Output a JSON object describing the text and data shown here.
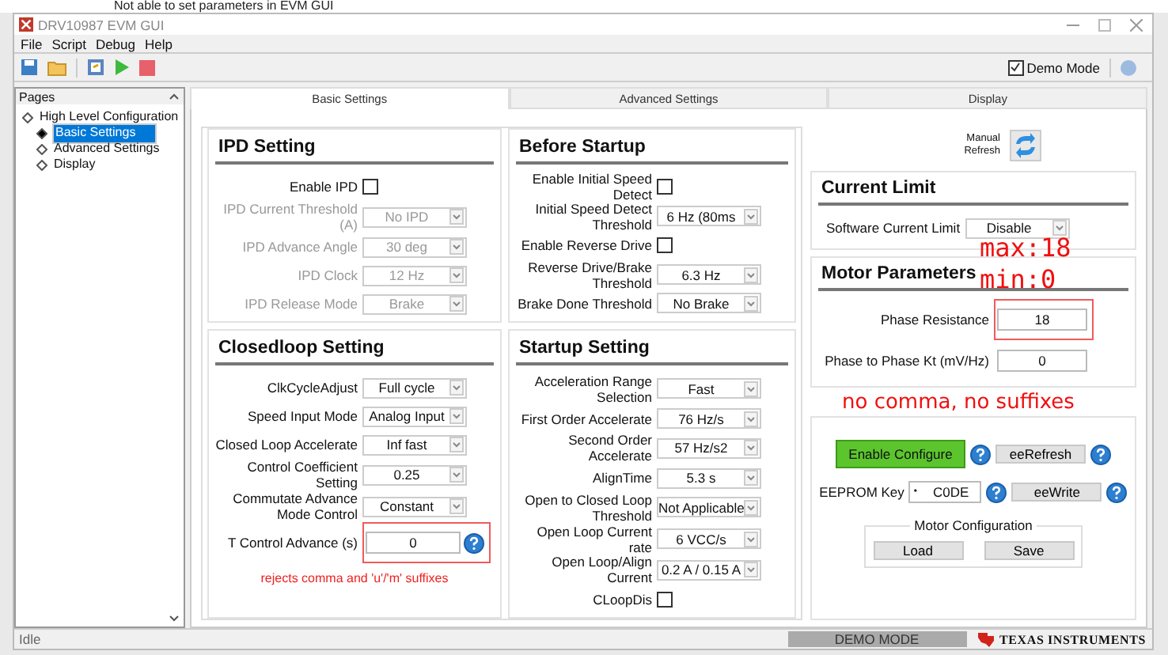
{
  "background_text": "Not able to set parameters in EVM GUI",
  "window": {
    "title": "DRV10987 EVM GUI"
  },
  "menu": [
    "File",
    "Script",
    "Debug",
    "Help"
  ],
  "demo_mode": {
    "label": "Demo Mode",
    "checked": true
  },
  "pages": {
    "title": "Pages",
    "tree": [
      {
        "label": "High Level Configuration",
        "selected": false,
        "children": [
          {
            "label": "Basic Settings",
            "selected": true
          },
          {
            "label": "Advanced Settings",
            "selected": false
          },
          {
            "label": "Display",
            "selected": false
          }
        ]
      }
    ]
  },
  "tabs": [
    {
      "label": "Basic Settings",
      "selected": true
    },
    {
      "label": "Advanced Settings",
      "selected": false
    },
    {
      "label": "Display",
      "selected": false
    }
  ],
  "sections": [
    {
      "title": "IPD Setting",
      "rows": [
        {
          "kind": "checkbox",
          "label": "Enable IPD",
          "checked": false,
          "disabled": false
        },
        {
          "kind": "select",
          "label": "IPD Current Threshold (A)",
          "value": "No IPD",
          "disabled": true
        },
        {
          "kind": "select",
          "label": "IPD Advance Angle",
          "value": "30 deg",
          "disabled": true
        },
        {
          "kind": "select",
          "label": "IPD Clock",
          "value": "12 Hz",
          "disabled": true
        },
        {
          "kind": "select",
          "label": "IPD Release Mode",
          "value": "Brake",
          "disabled": true
        }
      ]
    },
    {
      "title": "Before Startup",
      "rows": [
        {
          "kind": "checkbox",
          "label": "Enable Initial Speed Detect",
          "checked": false,
          "disabled": false
        },
        {
          "kind": "select",
          "label": "Initial Speed Detect Threshold",
          "value": "6 Hz (80ms",
          "disabled": false
        },
        {
          "kind": "checkbox",
          "label": "Enable Reverse Drive",
          "checked": false,
          "disabled": false
        },
        {
          "kind": "select",
          "label": "Reverse Drive/Brake Threshold",
          "value": "6.3 Hz",
          "disabled": false
        },
        {
          "kind": "select",
          "label": "Brake Done Threshold",
          "value": "No Brake",
          "disabled": false
        }
      ]
    },
    {
      "title": "Closedloop Setting",
      "note": "rejects comma and 'u'/'m' suffixes",
      "rows": [
        {
          "kind": "select",
          "label": "ClkCycleAdjust",
          "value": "Full cycle",
          "disabled": false
        },
        {
          "kind": "select",
          "label": "Speed Input Mode",
          "value": "Analog Input",
          "disabled": false
        },
        {
          "kind": "select",
          "label": "Closed Loop Accelerate",
          "value": "Inf fast",
          "disabled": false
        },
        {
          "kind": "select",
          "label": "Control Coefficient Setting",
          "value": "0.25",
          "disabled": false
        },
        {
          "kind": "select",
          "label": "Commutate Advance Mode Control",
          "value": "Constant",
          "disabled": false
        },
        {
          "kind": "input",
          "label": "T Control Advance (s)",
          "value": "0",
          "help": true,
          "highlighted": true,
          "disabled": false
        }
      ]
    },
    {
      "title": "Startup Setting",
      "rows": [
        {
          "kind": "select",
          "label": "Acceleration Range Selection",
          "value": "Fast",
          "disabled": false
        },
        {
          "kind": "select",
          "label": "First Order Accelerate",
          "value": "76 Hz/s",
          "disabled": false
        },
        {
          "kind": "select",
          "label": "Second Order Accelerate",
          "value": "57 Hz/s2",
          "disabled": false
        },
        {
          "kind": "select",
          "label": "AlignTime",
          "value": "5.3 s",
          "disabled": false
        },
        {
          "kind": "select",
          "label": "Open to Closed Loop Threshold",
          "value": "Not Applicable",
          "disabled": false
        },
        {
          "kind": "select",
          "label": "Open Loop Current rate",
          "value": "6 VCC/s",
          "disabled": false
        },
        {
          "kind": "select",
          "label": "Open Loop/Align Current",
          "value": "0.2 A / 0.15 A",
          "disabled": false
        },
        {
          "kind": "checkbox",
          "label": "CLoopDis",
          "checked": false,
          "disabled": false
        }
      ]
    }
  ],
  "manual_refresh": {
    "label": "Manual Refresh"
  },
  "current_limit": {
    "title": "Current Limit",
    "rows": [
      {
        "kind": "select",
        "label": "Software Current Limit",
        "value": "Disable"
      }
    ]
  },
  "motor_parameters": {
    "title": "Motor Parameters",
    "notes": [
      "max:18",
      "min:0"
    ],
    "note_below": "no comma, no suffixes",
    "rows": [
      {
        "kind": "input",
        "label": "Phase Resistance",
        "value": "18",
        "highlighted": true
      },
      {
        "kind": "input",
        "label": "Phase to Phase Kt (mV/Hz)",
        "value": "0",
        "highlighted": false
      }
    ]
  },
  "eeprom": {
    "enable_button": "Enable Configure",
    "refresh_button": "eeRefresh",
    "key_label": "EEPROM Key",
    "key_mask": "•",
    "key_value": "C0DE",
    "write_button": "eeWrite"
  },
  "motor_configuration": {
    "title": "Motor Configuration",
    "buttons": [
      "Load",
      "Save"
    ]
  },
  "status_bar": {
    "status": "Idle",
    "mode": "DEMO MODE",
    "logo": "TEXAS INSTRUMENTS"
  }
}
